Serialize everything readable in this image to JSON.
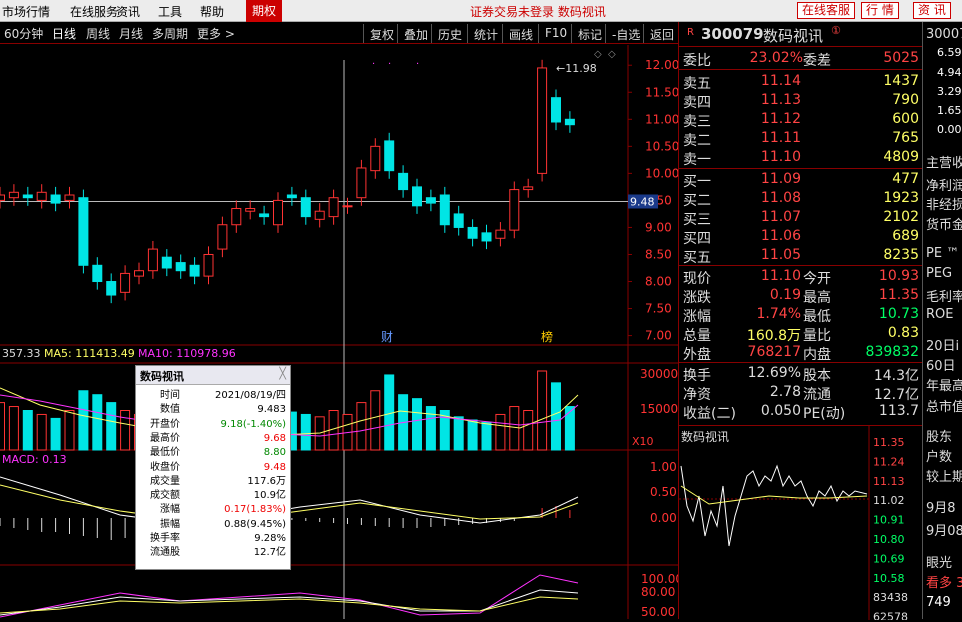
{
  "menu": {
    "items": [
      "市场行情",
      "在线服务",
      "资讯",
      "工具",
      "帮助"
    ],
    "period": "期权",
    "status": "证券交易未登录",
    "stock_name_title": "数码视讯",
    "buttons": [
      "在线客服",
      "行 情",
      "资 讯"
    ]
  },
  "toolbar": {
    "periods": [
      "60分钟",
      "日线",
      "周线",
      "月线",
      "多周期",
      "更多 >"
    ],
    "active": "日线",
    "buttons": [
      "复权",
      "叠加",
      "历史",
      "统计",
      "画线",
      "F10",
      "标记",
      "-自选",
      "返回"
    ]
  },
  "chart": {
    "price_axis": [
      "12.00",
      "11.50",
      "11.00",
      "10.50",
      "10.00",
      "9.50",
      "9.00",
      "8.50",
      "8.00",
      "7.50",
      "7.00"
    ],
    "current_price_tag": "9.48",
    "high_label": "11.98",
    "marker_cai": "财",
    "marker_bang": "榜",
    "vol_legend": {
      "a": "357.33",
      "ma5_label": "MA5: 111413.49",
      "ma10_label": "MA10: 110978.96"
    },
    "vol_axis": [
      "30000",
      "15000"
    ],
    "vol_unit": "X10",
    "macd_label": "MACD: 0.13",
    "macd_axis": [
      "1.00",
      "0.50",
      "0.00"
    ],
    "kdj_axis": [
      "100.00",
      "80.00",
      "50.00"
    ],
    "up_color": "#ff3333",
    "down_color": "#00e5e5",
    "ma5_color": "#ffff66",
    "ma10_color": "#ff33ff"
  },
  "chart_data": {
    "type": "candlestick",
    "note_units": "price in CNY",
    "candles": [
      {
        "o": 9.5,
        "c": 9.6
      },
      {
        "o": 9.55,
        "c": 9.65
      },
      {
        "o": 9.6,
        "c": 9.55
      },
      {
        "o": 9.5,
        "c": 9.65
      },
      {
        "o": 9.6,
        "c": 9.45
      },
      {
        "o": 9.5,
        "c": 9.6
      },
      {
        "o": 9.55,
        "c": 8.3
      },
      {
        "o": 8.3,
        "c": 8.0
      },
      {
        "o": 8.0,
        "c": 7.75
      },
      {
        "o": 7.8,
        "c": 8.15
      },
      {
        "o": 8.1,
        "c": 8.2
      },
      {
        "o": 8.2,
        "c": 8.6
      },
      {
        "o": 8.45,
        "c": 8.25
      },
      {
        "o": 8.35,
        "c": 8.2
      },
      {
        "o": 8.3,
        "c": 8.1
      },
      {
        "o": 8.1,
        "c": 8.5
      },
      {
        "o": 8.6,
        "c": 9.05
      },
      {
        "o": 9.05,
        "c": 9.35
      },
      {
        "o": 9.3,
        "c": 9.35
      },
      {
        "o": 9.25,
        "c": 9.2
      },
      {
        "o": 9.05,
        "c": 9.5
      },
      {
        "o": 9.6,
        "c": 9.55
      },
      {
        "o": 9.55,
        "c": 9.2
      },
      {
        "o": 9.15,
        "c": 9.3
      },
      {
        "o": 9.2,
        "c": 9.55
      },
      {
        "o": 9.4,
        "c": 9.4
      },
      {
        "o": 9.55,
        "c": 10.1
      },
      {
        "o": 10.05,
        "c": 10.5
      },
      {
        "o": 10.6,
        "c": 10.05
      },
      {
        "o": 10.0,
        "c": 9.7
      },
      {
        "o": 9.75,
        "c": 9.4
      },
      {
        "o": 9.55,
        "c": 9.45
      },
      {
        "o": 9.6,
        "c": 9.05
      },
      {
        "o": 9.25,
        "c": 9.0
      },
      {
        "o": 9.0,
        "c": 8.8
      },
      {
        "o": 8.9,
        "c": 8.75
      },
      {
        "o": 8.8,
        "c": 8.95
      },
      {
        "o": 8.95,
        "c": 9.7
      },
      {
        "o": 9.7,
        "c": 9.75
      },
      {
        "o": 10.0,
        "c": 11.95
      },
      {
        "o": 11.4,
        "c": 10.95
      },
      {
        "o": 11.0,
        "c": 10.9
      }
    ],
    "yrange": [
      6.9,
      12.3
    ]
  },
  "right": {
    "code": "300079",
    "name": "数码视讯",
    "code_color": "#ffff66",
    "name_color": "#ff4444",
    "weibi": {
      "label": "委比",
      "v1": "23.02%",
      "label2": "委差",
      "v2": "5025"
    },
    "asks": [
      {
        "l": "卖五",
        "p": "11.14",
        "v": "1437"
      },
      {
        "l": "卖四",
        "p": "11.13",
        "v": "790"
      },
      {
        "l": "卖三",
        "p": "11.12",
        "v": "600"
      },
      {
        "l": "卖二",
        "p": "11.11",
        "v": "765"
      },
      {
        "l": "卖一",
        "p": "11.10",
        "v": "4809"
      }
    ],
    "bids": [
      {
        "l": "买一",
        "p": "11.09",
        "v": "477"
      },
      {
        "l": "买二",
        "p": "11.08",
        "v": "1923"
      },
      {
        "l": "买三",
        "p": "11.07",
        "v": "2102"
      },
      {
        "l": "买四",
        "p": "11.06",
        "v": "689"
      },
      {
        "l": "买五",
        "p": "11.05",
        "v": "8235"
      }
    ],
    "quote": [
      {
        "l1": "现价",
        "v1": "11.10",
        "l2": "今开",
        "v2": "10.93",
        "c1": "#ff4444",
        "c2": "#ff4444"
      },
      {
        "l1": "涨跌",
        "v1": "0.19",
        "l2": "最高",
        "v2": "11.35",
        "c1": "#ff4444",
        "c2": "#ff4444"
      },
      {
        "l1": "涨幅",
        "v1": "1.74%",
        "l2": "最低",
        "v2": "10.73",
        "c1": "#ff4444",
        "c2": "#00ff66"
      },
      {
        "l1": "总量",
        "v1": "160.8万",
        "l2": "量比",
        "v2": "0.83",
        "c1": "#ffff66",
        "c2": "#ffff66"
      },
      {
        "l1": "外盘",
        "v1": "768217",
        "l2": "内盘",
        "v2": "839832",
        "c1": "#ff4444",
        "c2": "#00ff66"
      }
    ],
    "fin": [
      {
        "l1": "换手",
        "v1": "12.69%",
        "l2": "股本",
        "v2": "14.3亿"
      },
      {
        "l1": "净资",
        "v1": "2.78",
        "l2": "流通",
        "v2": "12.7亿"
      },
      {
        "l1": "收益(二)",
        "v1": "0.050",
        "l2": "PE(动)",
        "v2": "113.7"
      }
    ],
    "intraday_title": "数码视讯",
    "intraday_axis": [
      "11.35",
      "11.24",
      "11.13",
      "11.02",
      "10.91",
      "10.80",
      "10.69",
      "10.58",
      "83438",
      "62578"
    ]
  },
  "farright": {
    "items": [
      "30007",
      "6.59",
      "4.94",
      "3.29",
      "1.65",
      "0.00",
      "主营收",
      "净利润",
      "非经损",
      "货币金",
      "PE ™",
      "PEG",
      "毛利率",
      "ROE",
      "20日i",
      "60日",
      "年最高",
      "总市值",
      "股东",
      "户数",
      "较上期",
      "9月8",
      "9月08",
      "眼光",
      "看多 3",
      "749"
    ]
  },
  "tooltip": {
    "title": "数码视讯",
    "rows": [
      {
        "k": "时间",
        "v": "2021/08/19/四",
        "c": "#000"
      },
      {
        "k": "数值",
        "v": "9.483",
        "c": "#000"
      },
      {
        "k": "开盘价",
        "v": "9.18(-1.40%)",
        "c": "#008800"
      },
      {
        "k": "最高价",
        "v": "9.68",
        "c": "#e00"
      },
      {
        "k": "最低价",
        "v": "8.80",
        "c": "#008800"
      },
      {
        "k": "收盘价",
        "v": "9.48",
        "c": "#e00"
      },
      {
        "k": "成交量",
        "v": "117.6万",
        "c": "#000"
      },
      {
        "k": "成交额",
        "v": "10.9亿",
        "c": "#000"
      },
      {
        "k": "涨幅",
        "v": "0.17(1.83%)",
        "c": "#e00"
      },
      {
        "k": "振幅",
        "v": "0.88(9.45%)",
        "c": "#000"
      },
      {
        "k": "换手率",
        "v": "9.28%",
        "c": "#000"
      },
      {
        "k": "流通股",
        "v": "12.7亿",
        "c": "#000"
      }
    ]
  }
}
